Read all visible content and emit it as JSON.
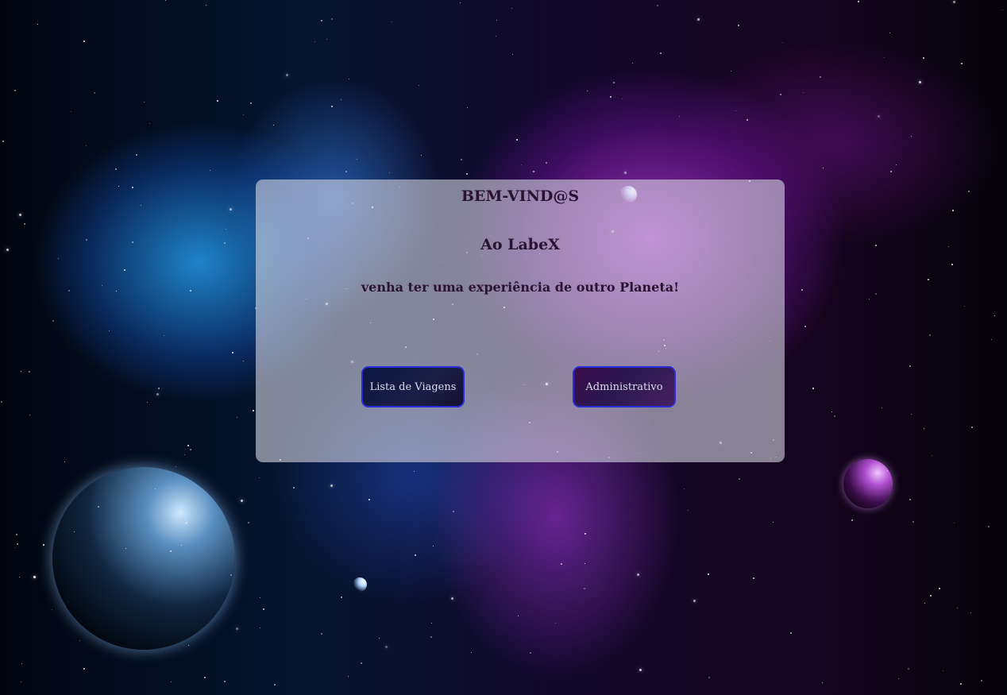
{
  "welcome": {
    "title": "BEM-VIND@S",
    "brand": "Ao LabeX",
    "tagline": "venha ter uma experiência de outro Planeta!"
  },
  "actions": {
    "trips_label": "Lista de Viagens",
    "admin_label": "Administrativo"
  },
  "colors": {
    "card_overlay": "#dcdce8",
    "text": "#2a1232",
    "button_border": "#2a2cd8",
    "button_text": "#dcdcf0"
  }
}
